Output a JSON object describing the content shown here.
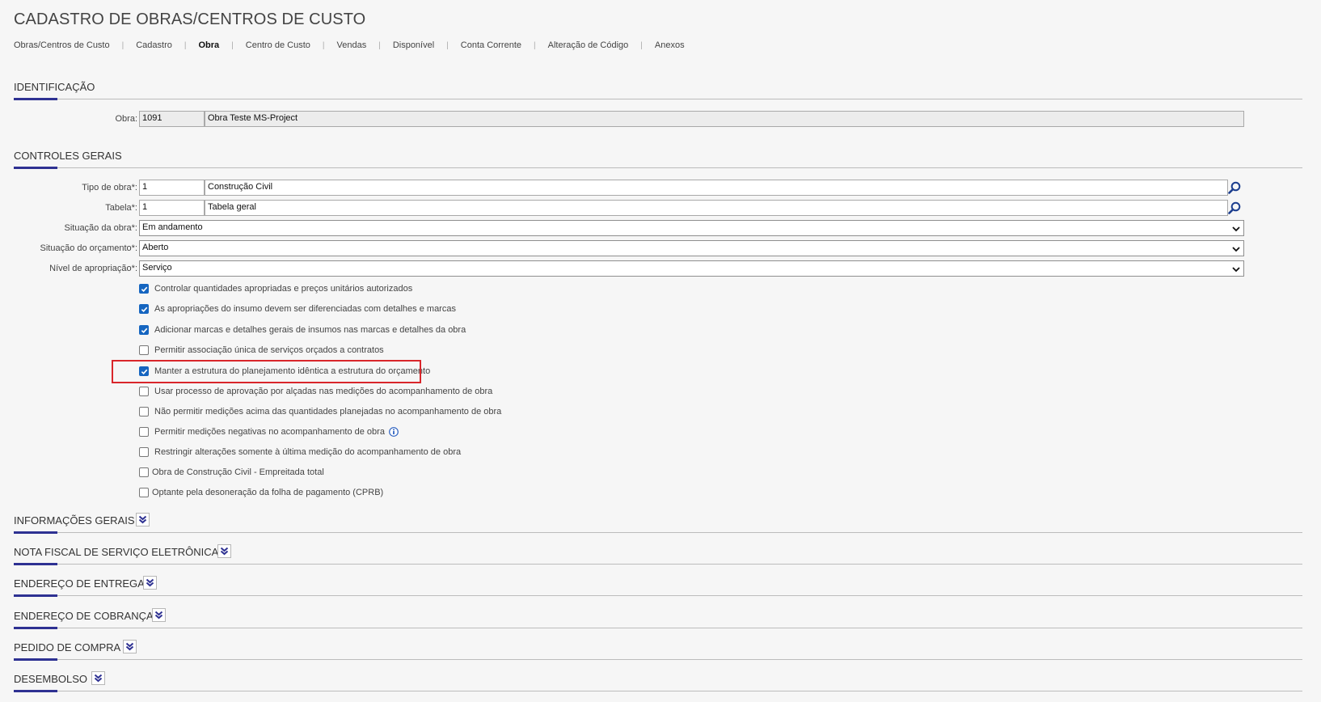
{
  "title": "CADASTRO DE OBRAS/CENTROS DE CUSTO",
  "nav": [
    {
      "label": "Obras/Centros de Custo",
      "active": false
    },
    {
      "label": "Cadastro",
      "active": false
    },
    {
      "label": "Obra",
      "active": true
    },
    {
      "label": "Centro de Custo",
      "active": false
    },
    {
      "label": "Vendas",
      "active": false
    },
    {
      "label": "Disponível",
      "active": false
    },
    {
      "label": "Conta Corrente",
      "active": false
    },
    {
      "label": "Alteração de Código",
      "active": false
    },
    {
      "label": "Anexos",
      "active": false
    }
  ],
  "identificacao": {
    "title": "IDENTIFICAÇÃO",
    "obra_label": "Obra:",
    "obra_code": "1091",
    "obra_name": "Obra Teste MS-Project"
  },
  "controles": {
    "title": "CONTROLES GERAIS",
    "tipo_label": "Tipo de obra*:",
    "tipo_code": "1",
    "tipo_name": "Construção Civil",
    "tabela_label": "Tabela*:",
    "tabela_code": "1",
    "tabela_name": "Tabela geral",
    "situacao_obra_label": "Situação da obra*:",
    "situacao_obra_value": "Em andamento",
    "situacao_orc_label": "Situação do orçamento*:",
    "situacao_orc_value": "Aberto",
    "nivel_label": "Nível de apropriação*:",
    "nivel_value": "Serviço",
    "checkboxes": [
      {
        "label": "Controlar quantidades apropriadas e preços unitários autorizados",
        "checked": true
      },
      {
        "label": "As apropriações do insumo devem ser diferenciadas com detalhes e marcas",
        "checked": true
      },
      {
        "label": "Adicionar marcas e detalhes gerais de insumos nas marcas e detalhes da obra",
        "checked": true
      },
      {
        "label": "Permitir associação única de serviços orçados a contratos",
        "checked": false
      },
      {
        "label": "Manter a estrutura do planejamento idêntica a estrutura do orçamento",
        "checked": true
      },
      {
        "label": "Usar processo de aprovação por alçadas nas medições do acompanhamento de obra",
        "checked": false
      },
      {
        "label": "Não permitir medições acima das quantidades planejadas no acompanhamento de obra",
        "checked": false
      },
      {
        "label": "Permitir medições negativas no acompanhamento de obra",
        "checked": false
      },
      {
        "label": "Restringir alterações somente à última medição do acompanhamento de obra",
        "checked": false
      },
      {
        "label": "Obra de Construção Civil - Empreitada total",
        "checked": false
      },
      {
        "label": "Optante pela desoneração da folha de pagamento (CPRB)",
        "checked": false
      }
    ]
  },
  "collapsed_sections": [
    "INFORMAÇÕES GERAIS",
    "NOTA FISCAL DE SERVIÇO ELETRÔNICA",
    "ENDEREÇO DE ENTREGA",
    "ENDEREÇO DE COBRANÇA",
    "PEDIDO DE COMPRA",
    "DESEMBOLSO"
  ],
  "colors": {
    "accent": "#2e3192",
    "checkbox_blue": "#1565c0",
    "highlight_red": "#d9262b"
  },
  "icons": {
    "lookup": "search-icon",
    "dropdown": "chevron-down-icon",
    "expand": "double-chevron-down-icon",
    "info": "info-icon"
  }
}
